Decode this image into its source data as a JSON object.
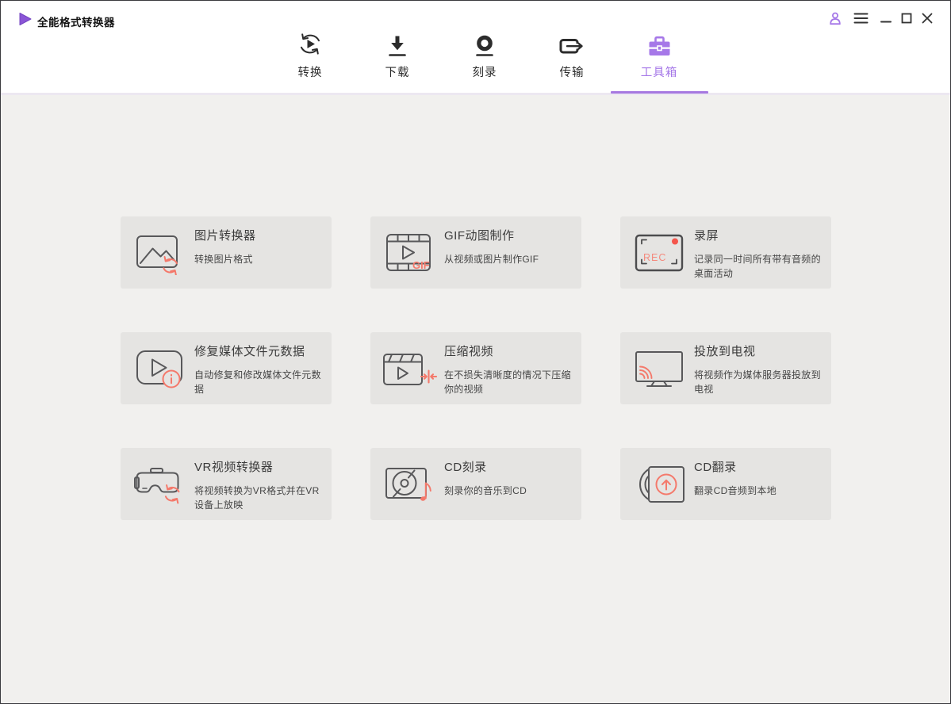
{
  "window": {
    "title": "全能格式转换器"
  },
  "nav": {
    "tabs": [
      {
        "label": "转换",
        "icon": "convert-icon",
        "active": false
      },
      {
        "label": "下载",
        "icon": "download-icon",
        "active": false
      },
      {
        "label": "刻录",
        "icon": "burn-icon",
        "active": false
      },
      {
        "label": "传输",
        "icon": "transfer-icon",
        "active": false
      },
      {
        "label": "工具箱",
        "icon": "toolbox-icon",
        "active": true
      }
    ]
  },
  "toolbox": {
    "cards": [
      {
        "title": "图片转换器",
        "description": "转换图片格式",
        "icon": "image-converter-icon"
      },
      {
        "title": "GIF动图制作",
        "description": "从视频或图片制作GIF",
        "icon": "gif-maker-icon"
      },
      {
        "title": "录屏",
        "description": "记录同一时间所有带有音频的桌面活动",
        "icon": "screen-recorder-icon"
      },
      {
        "title": "修复媒体文件元数据",
        "description": "自动修复和修改媒体文件元数据",
        "icon": "fix-metadata-icon"
      },
      {
        "title": "压缩视频",
        "description": "在不损失清晰度的情况下压缩你的视频",
        "icon": "compress-video-icon"
      },
      {
        "title": "投放到电视",
        "description": "将视频作为媒体服务器投放到电视",
        "icon": "cast-to-tv-icon"
      },
      {
        "title": "VR视频转换器",
        "description": "将视频转换为VR格式并在VR设备上放映",
        "icon": "vr-converter-icon"
      },
      {
        "title": "CD刻录",
        "description": "刻录你的音乐到CD",
        "icon": "cd-burn-icon"
      },
      {
        "title": "CD翻录",
        "description": "翻录CD音频到本地",
        "icon": "cd-rip-icon"
      }
    ]
  },
  "colors": {
    "accent_purple": "#a678e8",
    "underline_purple": "#a678e0",
    "icon_salmon": "#f4796b",
    "record_red": "#f4564c",
    "card_bg": "#e5e4e2",
    "content_bg": "#f1f0ee",
    "header_bg": "#ffffff"
  }
}
